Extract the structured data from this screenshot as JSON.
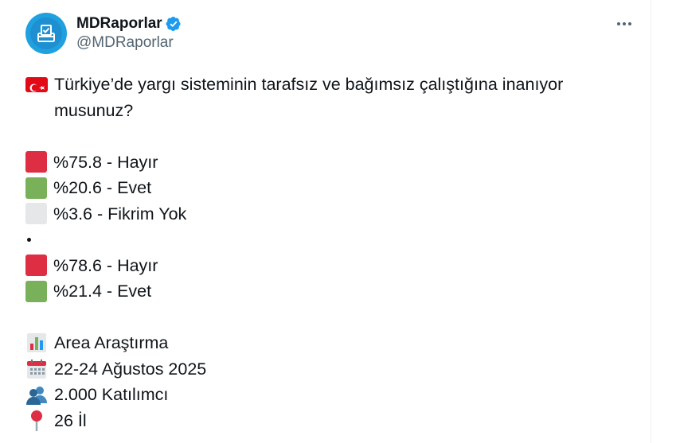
{
  "tweet": {
    "display_name": "MDRaporlar",
    "handle": "@MDRaporlar",
    "verified_icon": "verified-badge-icon",
    "more_icon": "more-options-icon",
    "question": "Türkiye’de yargı sisteminin tarafsız ve bağımsız çalıştığına inanıyor musunuz?",
    "results_1": [
      {
        "color": "red",
        "text": "%75.8 - Hayır"
      },
      {
        "color": "green",
        "text": "%20.6 - Evet"
      },
      {
        "color": "white",
        "text": "%3.6 - Fikrim Yok"
      }
    ],
    "separator": "•",
    "results_2": [
      {
        "color": "red",
        "text": "%78.6 - Hayır"
      },
      {
        "color": "green",
        "text": "%21.4 - Evet"
      }
    ],
    "source": "Area Araştırma",
    "date": "22-24 Ağustos 2025",
    "participants": "2.000 Katılımcı",
    "provinces": "26 İl"
  },
  "colors": {
    "red": "#dd2e44",
    "green": "#78b159",
    "white": "#e6e7e8",
    "verified": "#1d9bf0",
    "avatar": "#1fa1e0"
  }
}
